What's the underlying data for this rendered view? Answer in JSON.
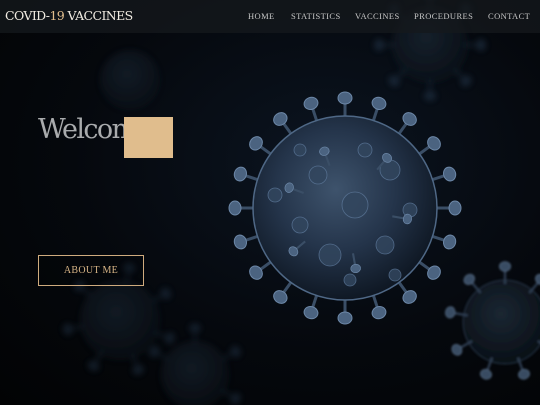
{
  "brand": {
    "prefix": "COVID-",
    "number": "19",
    "suffix": " VACCINES",
    "accent_color": "#e3bf8e"
  },
  "nav": {
    "home": "HOME",
    "statistics": "STATISTICS",
    "vaccines": "VACCINES",
    "procedures": "PROCEDURES",
    "contact": "CONTACT"
  },
  "hero": {
    "title": "Welcom",
    "button_label": "ABOUT ME",
    "background_image": "dark-blue-coronavirus-illustration",
    "accent_color": "#e0bd8d"
  }
}
